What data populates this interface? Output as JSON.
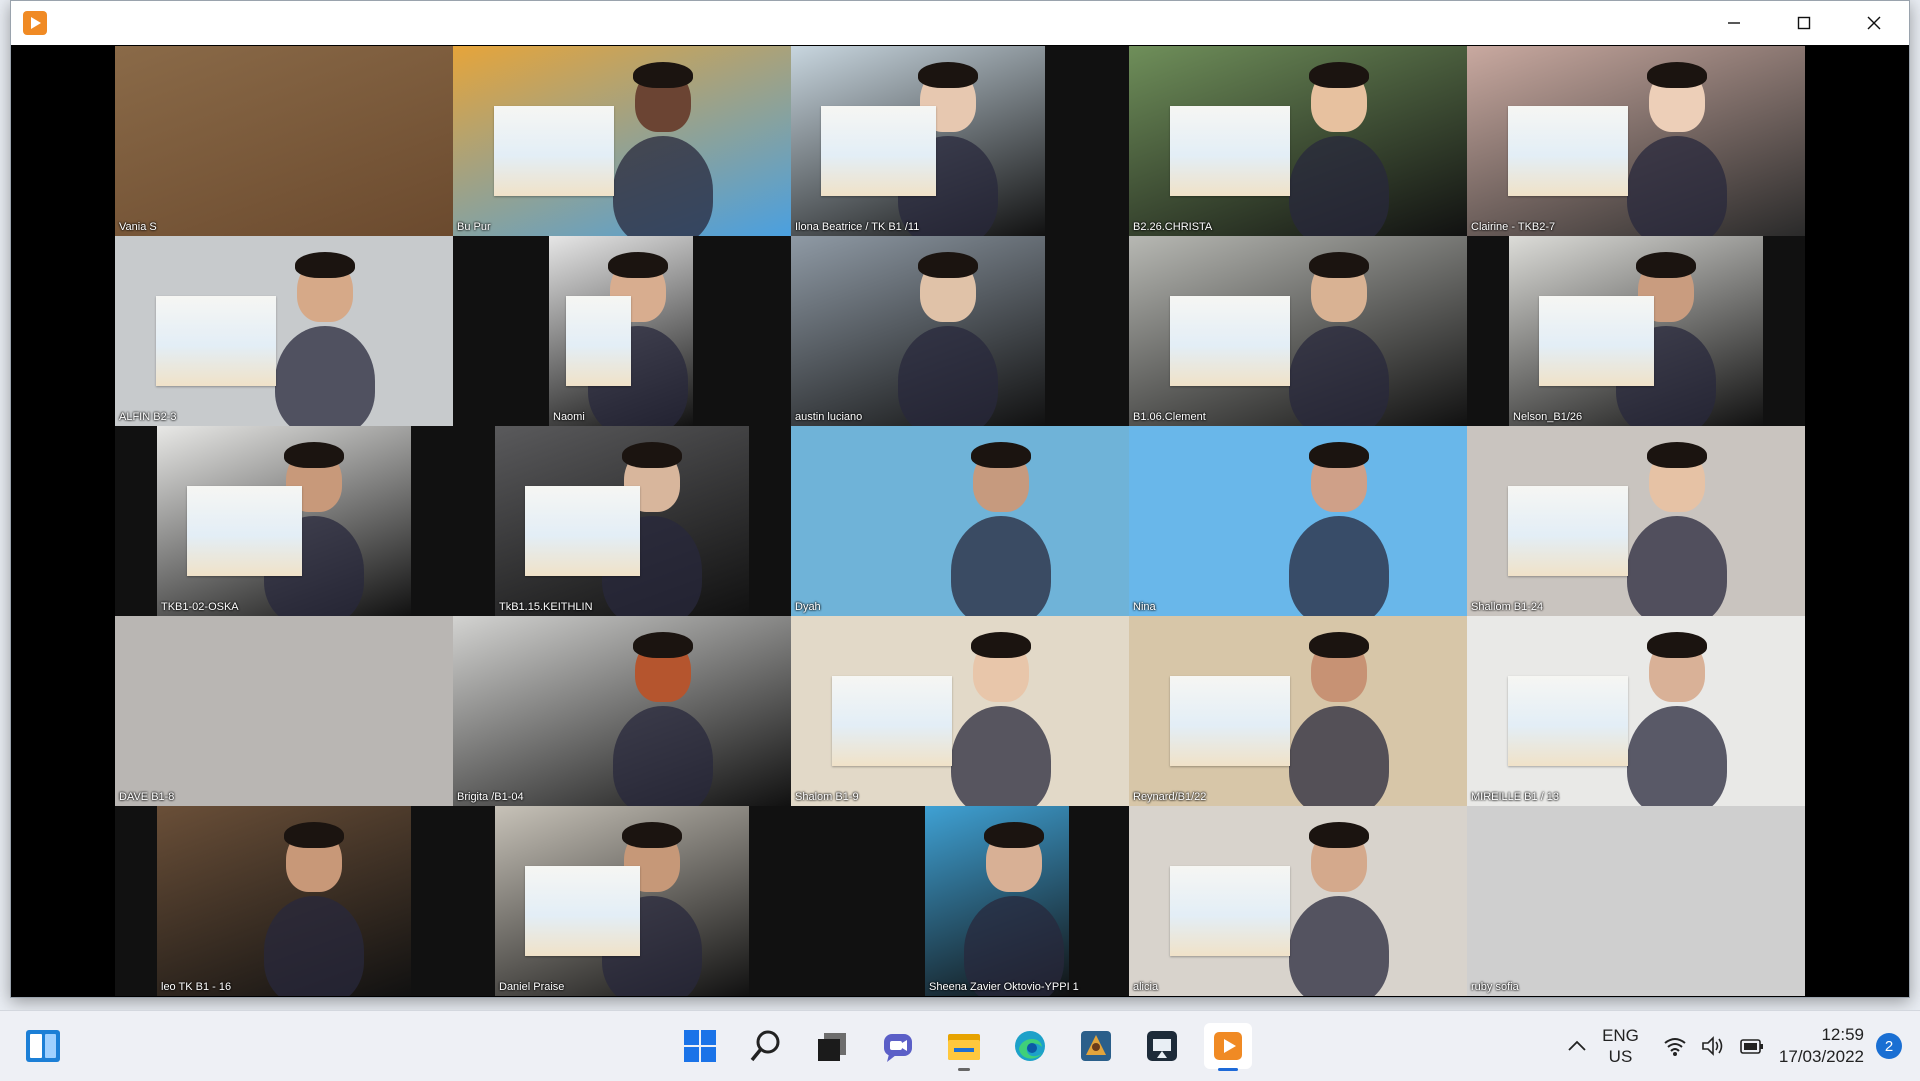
{
  "window": {
    "title": ""
  },
  "participants": [
    {
      "name": "Vania S",
      "bg": "#6b4a2e",
      "video_color": "#8a6a48",
      "skin": "",
      "paper": false
    },
    {
      "name": "Bu Pur",
      "bg": "#4aa0e0",
      "video_color": "#e6a43a",
      "skin": "#6b4433",
      "paper": true
    },
    {
      "name": "Ilona Beatrice / TK B1 /11",
      "bg": "#111111",
      "video_color": "#c8d6df",
      "skin": "#e7c8b0",
      "paper": true
    },
    {
      "name": "B2.26.CHRISTA",
      "bg": "#111111",
      "video_color": "#6f8f5a",
      "skin": "#e7c19f",
      "paper": true
    },
    {
      "name": "Clairine - TKB2-7",
      "bg": "#2a2a2a",
      "video_color": "#c9a9a0",
      "skin": "#edcfb8",
      "paper": true
    },
    {
      "name": "ALFIN B2-3",
      "bg": "#c7cacc",
      "video_color": "#c7cacc",
      "skin": "#d6a988",
      "paper": true
    },
    {
      "name": "Naomi",
      "bg": "#111111",
      "video_color": "#e6e6e6",
      "skin": "#d8ad8f",
      "paper": true
    },
    {
      "name": "austin luciano",
      "bg": "#111111",
      "video_color": "#8f9aa5",
      "skin": "#e0c2a8",
      "paper": false
    },
    {
      "name": "B1.06.Clement",
      "bg": "#111111",
      "video_color": "#b7b8b3",
      "skin": "#d9b293",
      "paper": true
    },
    {
      "name": "Nelson_B1/26",
      "bg": "#111111",
      "video_color": "#dcdcd8",
      "skin": "#c99c7f",
      "paper": true
    },
    {
      "name": "TKB1-02-OSKA",
      "bg": "#111111",
      "video_color": "#e8e8e6",
      "skin": "#c8997a",
      "paper": true
    },
    {
      "name": "TkB1.15.KEITHLIN",
      "bg": "#111111",
      "video_color": "#5a5a5c",
      "skin": "#d8b69c",
      "paper": true
    },
    {
      "name": "Dyah",
      "bg": "#6fb3d8",
      "video_color": "#6fb3d8",
      "skin": "#c69a7e",
      "paper": false
    },
    {
      "name": "Nina",
      "bg": "#69b7ea",
      "video_color": "#69b7ea",
      "skin": "#cfa088",
      "paper": false
    },
    {
      "name": "Shallom B1-24",
      "bg": "#c9c4bf",
      "video_color": "#c9c4bf",
      "skin": "#e6c2a5",
      "paper": true
    },
    {
      "name": "DAVE B1-8",
      "bg": "#b9b6b3",
      "video_color": "#b9b6b3",
      "skin": "",
      "paper": false
    },
    {
      "name": "Brigita /B1-04",
      "bg": "#111111",
      "video_color": "#d3d3d1",
      "skin": "#b5552e",
      "paper": false
    },
    {
      "name": "Shalom B1-9",
      "bg": "#e2d9c8",
      "video_color": "#e2d9c8",
      "skin": "#e8c6aa",
      "paper": true
    },
    {
      "name": "Reynard/B1/22",
      "bg": "#d7c6a8",
      "video_color": "#d7c6a8",
      "skin": "#c79274",
      "paper": true
    },
    {
      "name": "MIREILLE B1 / 13",
      "bg": "#e9e9e7",
      "video_color": "#e9e9e7",
      "skin": "#d9b197",
      "paper": true
    },
    {
      "name": "leo TK B1 - 16",
      "bg": "#111111",
      "video_color": "#6a4f38",
      "skin": "#c89878",
      "paper": false
    },
    {
      "name": "Daniel Praise",
      "bg": "#111111",
      "video_color": "#c7c2b8",
      "skin": "#c69878",
      "paper": true
    },
    {
      "name": "Sheena Zavier Oktovio-YPPI 1",
      "bg": "#111111",
      "video_color": "#3fa1d4",
      "skin": "#d8b095",
      "paper": false
    },
    {
      "name": "alicia",
      "bg": "#d8d3cc",
      "video_color": "#d8d3cc",
      "skin": "#d4a98c",
      "paper": true
    },
    {
      "name": "ruby sofia",
      "bg": "#cfcfcf",
      "video_color": "#cfcfcf",
      "skin": "",
      "paper": false
    }
  ],
  "taskbar": {
    "apps": [
      {
        "name": "windows-start-icon"
      },
      {
        "name": "search-icon"
      },
      {
        "name": "task-view-icon"
      },
      {
        "name": "chat-icon"
      },
      {
        "name": "file-explorer-icon"
      },
      {
        "name": "edge-icon"
      },
      {
        "name": "app-gold-icon"
      },
      {
        "name": "app-dark-icon"
      },
      {
        "name": "video-app-icon",
        "active": true
      }
    ],
    "language": {
      "line1": "ENG",
      "line2": "US"
    },
    "time": "12:59",
    "date": "17/03/2022",
    "notifications": "2"
  }
}
